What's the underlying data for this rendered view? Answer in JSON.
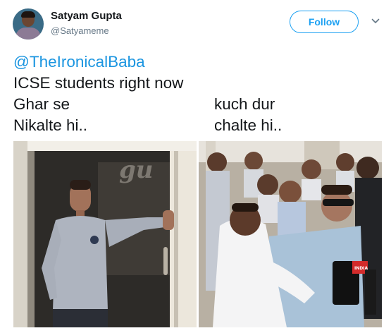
{
  "author": {
    "name": "Satyam Gupta",
    "handle": "@Satyameme"
  },
  "actions": {
    "follow_label": "Follow",
    "more_icon": "chevron-down-icon"
  },
  "tweet": {
    "mention": "@TheIronicalBaba",
    "line1": "ICSE students right now",
    "left_col": [
      "Ghar se",
      "Nikalte hi.."
    ],
    "right_col": [
      "kuch dur",
      "chalte hi.."
    ]
  },
  "media": {
    "count": 2,
    "left_photo": "man-leaving-doorway-photo",
    "right_photo": "man-in-crowd-with-press-photo",
    "left_sign_fragment": "gu",
    "right_mic_text": "INDIA"
  },
  "colors": {
    "accent": "#1da1f2",
    "mention": "#1b95e0",
    "muted": "#657786",
    "text": "#14171a"
  }
}
